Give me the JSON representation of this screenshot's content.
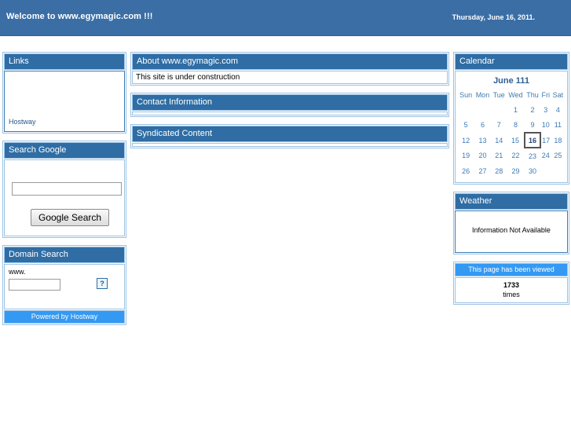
{
  "banner": {
    "title": "Welcome to www.egymagic.com !!!",
    "date": "Thursday, June 16, 2011.",
    "bg_color": "#3a6ea5"
  },
  "theme": {
    "panel_header_bg": "#2f6da4",
    "panel_border": "#9cc3e4",
    "accent_blue": "#3399f3",
    "link_color": "#26558b"
  },
  "sidebar_left": {
    "links_panel": {
      "title": "Links",
      "items": [
        {
          "label": "Hostway"
        }
      ]
    },
    "google_search_panel": {
      "title": "Search Google",
      "input_value": "",
      "input_placeholder": "",
      "button_label": "Google Search"
    },
    "domain_search_panel": {
      "title": "Domain Search",
      "prefix_label": "www.",
      "input_value": "",
      "input_placeholder": "",
      "help_label": "?",
      "footer_label": "Powered by Hostway"
    }
  },
  "main": {
    "panels": [
      {
        "title": "About www.egymagic.com",
        "body": "This site is under construction",
        "has_body": true
      },
      {
        "title": "Contact Information",
        "body": "",
        "has_body": false
      },
      {
        "title": "Syndicated Content",
        "body": "",
        "has_body": false
      }
    ]
  },
  "sidebar_right": {
    "calendar_panel": {
      "title": "Calendar",
      "month_label": "June 111",
      "weekdays": [
        "Sun",
        "Mon",
        "Tue",
        "Wed",
        "Thu",
        "Fri",
        "Sat"
      ],
      "today": 16,
      "weeks": [
        [
          "",
          "",
          "",
          "1",
          "2",
          "3",
          "4"
        ],
        [
          "5",
          "6",
          "7",
          "8",
          "9",
          "10",
          "11"
        ],
        [
          "12",
          "13",
          "14",
          "15",
          "16",
          "17",
          "18"
        ],
        [
          "19",
          "20",
          "21",
          "22",
          "23",
          "24",
          "25"
        ],
        [
          "26",
          "27",
          "28",
          "29",
          "30",
          "",
          ""
        ]
      ]
    },
    "weather_panel": {
      "title": "Weather",
      "message": "Information Not Available"
    },
    "counter_panel": {
      "header": "This page has been viewed",
      "count": "1733",
      "unit": "times"
    }
  }
}
